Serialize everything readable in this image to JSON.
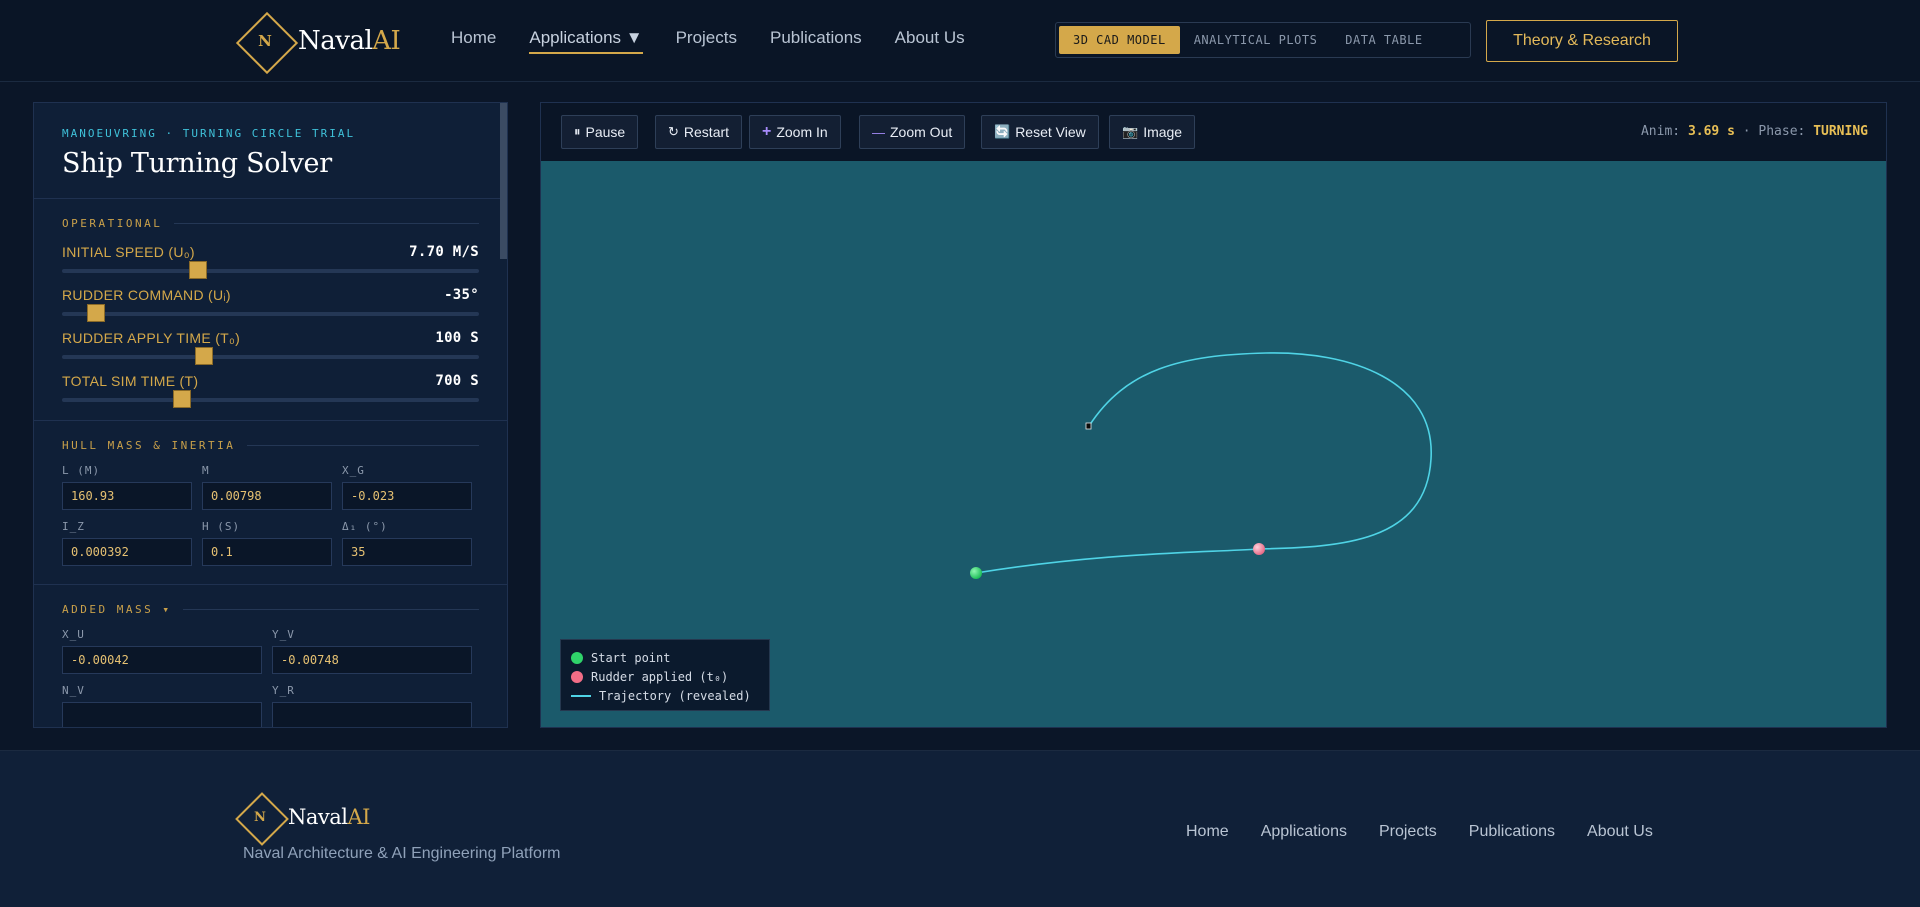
{
  "header": {
    "logo_letter": "N",
    "logo_name": "Naval",
    "logo_ai": "AI",
    "nav": [
      "Home",
      "Applications ▼",
      "Projects",
      "Publications",
      "About Us"
    ],
    "view_modes": [
      "3D CAD MODEL",
      "ANALYTICAL PLOTS",
      "DATA TABLE"
    ],
    "theory_button": "Theory & Research"
  },
  "panel": {
    "kicker": "MANOEUVRING · TURNING CIRCLE TRIAL",
    "title": "Ship Turning Solver",
    "operational": {
      "label": "OPERATIONAL",
      "sliders": [
        {
          "label": "INITIAL SPEED (U₀)",
          "value": "7.70 M/S",
          "level": 0.325
        },
        {
          "label": "RUDDER COMMAND (Uᵢ)",
          "value": "-35°",
          "level": 0.082
        },
        {
          "label": "RUDDER APPLY TIME (T₀)",
          "value": "100 S",
          "level": 0.34
        },
        {
          "label": "TOTAL SIM TIME (T)",
          "value": "700 S",
          "level": 0.288
        }
      ]
    },
    "hull": {
      "label": "HULL MASS & INERTIA",
      "fields": [
        {
          "label": "L (M)",
          "value": "160.93"
        },
        {
          "label": "M",
          "value": "0.00798"
        },
        {
          "label": "X_G",
          "value": "-0.023"
        },
        {
          "label": "I_Z",
          "value": "0.000392"
        },
        {
          "label": "H (S)",
          "value": "0.1"
        },
        {
          "label": "Δ₁ (°)",
          "value": "35"
        }
      ]
    },
    "added_mass": {
      "label": "ADDED MASS ▾",
      "fields": [
        {
          "label": "X_U",
          "value": "-0.00042"
        },
        {
          "label": "Y_V",
          "value": "-0.00748"
        },
        {
          "label": "N_V",
          "value": ""
        },
        {
          "label": "Y_R",
          "value": ""
        }
      ]
    }
  },
  "viewer": {
    "buttons": [
      {
        "icon": "⏸",
        "label": "Pause"
      },
      {
        "icon": "↻",
        "label": "Restart"
      },
      {
        "icon": "+",
        "label": "Zoom In"
      },
      {
        "icon": "—",
        "label": "Zoom Out"
      },
      {
        "icon": "🔄",
        "label": "Reset View"
      },
      {
        "icon": "📷",
        "label": "Image"
      }
    ],
    "anim_label": "Anim:",
    "anim_value": "3.69 s",
    "phase_label": "· Phase:",
    "phase_value": "TURNING",
    "legend": [
      {
        "label": "Start point",
        "color": "#2fd36a"
      },
      {
        "label": "Rudder applied (t₀)",
        "color": "#f26d86"
      },
      {
        "label": "Trajectory (revealed)",
        "color": "#4fd4e6"
      }
    ]
  },
  "footer": {
    "logo_letter": "N",
    "logo_name": "Naval",
    "logo_ai": "AI",
    "tagline": "Naval Architecture & AI Engineering Platform",
    "nav": [
      "Home",
      "Applications",
      "Projects",
      "Publications",
      "About Us"
    ]
  },
  "colors": {
    "accent": "#d4a84a",
    "water": "#1b5a6b",
    "trajectory": "#4fd4e6"
  }
}
